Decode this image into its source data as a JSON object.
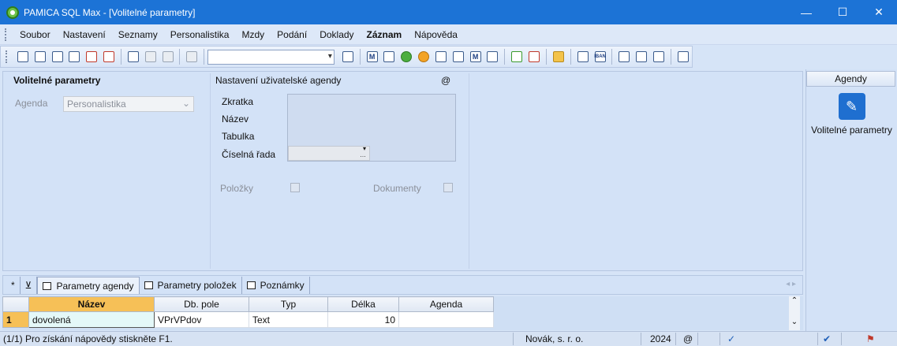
{
  "window": {
    "title": "PAMICA SQL Max - [Volitelné parametry]",
    "minimize": "—",
    "maximize": "☐",
    "close": "✕"
  },
  "menu": [
    "Soubor",
    "Nastavení",
    "Seznamy",
    "Personalistika",
    "Mzdy",
    "Podání",
    "Doklady",
    "Záznam",
    "Nápověda"
  ],
  "toolbar": {
    "combo_value": ""
  },
  "left_section": {
    "title": "Volitelné parametry",
    "agenda_label": "Agenda",
    "agenda_value": "Personalistika"
  },
  "user_agenda": {
    "title": "Nastavení uživatelské agendy",
    "at_symbol": "@",
    "zkratka": "Zkratka",
    "nazev": "Název",
    "tabulka": "Tabulka",
    "ciselna_rada": "Číselná řada",
    "polozky": "Položky",
    "dokumenty": "Dokumenty"
  },
  "side": {
    "header": "Agendy",
    "item_label": "Volitelné parametry"
  },
  "tabs": {
    "star": "*",
    "filter": "⊻",
    "items": [
      "Parametry agendy",
      "Parametry položek",
      "Poznámky"
    ],
    "nav": "◂ ▸"
  },
  "grid": {
    "columns": [
      "Název",
      "Db. pole",
      "Typ",
      "Délka",
      "Agenda"
    ],
    "rows": [
      {
        "num": "1",
        "nazev": "dovolená",
        "db_pole": "VPrVPdov",
        "typ": "Text",
        "delka": "10",
        "agenda": ""
      }
    ]
  },
  "status": {
    "help": "(1/1) Pro získání nápovědy stiskněte F1.",
    "company": "Novák, s. r. o.",
    "year": "2024",
    "at": "@"
  }
}
